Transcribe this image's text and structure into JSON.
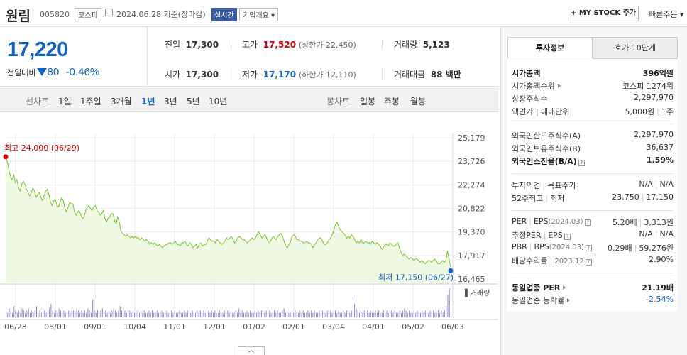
{
  "header": {
    "name": "원림",
    "code": "005820",
    "market": "코스피",
    "date": "2024.06.28 기준(장마감)",
    "realtime": "실시간",
    "overview": "기업개요 ▾",
    "mystock": "+ MY STOCK 추가",
    "quick_order": "빠른주문 ▾"
  },
  "summary": {
    "price": "17,220",
    "change_label": "전일대비",
    "change_amount": "80",
    "change_rate": "-0.46%",
    "prev_label": "전일",
    "prev": "17,300",
    "open_label": "시가",
    "open": "17,300",
    "high_label": "고가",
    "high": "17,520",
    "upper_limit": "(상한가 22,450)",
    "low_label": "저가",
    "low": "17,170",
    "lower_limit": "(하한가 12,110)",
    "volume_label": "거래량",
    "volume": "5,123",
    "amount_label": "거래대금",
    "amount": "88 백만"
  },
  "tabs": {
    "line_label": "선차트",
    "periods": [
      "1일",
      "1주일",
      "3개월",
      "1년",
      "3년",
      "5년",
      "10년"
    ],
    "active": "1년",
    "candle_label": "봉차트",
    "candles": [
      "일봉",
      "주봉",
      "월봉"
    ]
  },
  "chart_data": {
    "type": "line",
    "title": "",
    "x_ticks": [
      "06/28",
      "08/01",
      "09/01",
      "10/04",
      "11/01",
      "12/01",
      "01/02",
      "02/01",
      "03/04",
      "04/01",
      "05/02",
      "06/03"
    ],
    "y_ticks": [
      25179,
      23726,
      22274,
      20822,
      19370,
      17917,
      16465
    ],
    "ylim": [
      16465,
      25179
    ],
    "high_annotation": "최고 24,000 (06/29)",
    "low_annotation": "최저 17,150 (06/27)",
    "volume_label": "▌거래량",
    "grid": true,
    "series": [
      {
        "values": [
          24000,
          23700,
          23200,
          22800,
          22600,
          22900,
          22400,
          22600,
          22100,
          21900,
          22300,
          22500,
          22300,
          22000,
          21800,
          21600,
          21800,
          22100,
          21900,
          21500,
          21700,
          21800,
          21500,
          21300,
          21600,
          21900,
          22000,
          21700,
          21200,
          21000,
          21300,
          21400,
          21000,
          20900,
          21200,
          21500,
          21300,
          20800,
          20600,
          20900,
          21200,
          21100,
          21100,
          20600,
          20400,
          20600,
          20700,
          20400,
          20200,
          20300,
          20700,
          20900,
          21000,
          20800,
          20700,
          20900,
          21000,
          20700,
          20600,
          20400,
          20500,
          20700,
          20200,
          20000,
          20200,
          20300,
          20500,
          20500,
          20100,
          19900,
          20300,
          20000,
          19400,
          19300,
          19200,
          19100,
          19200,
          19100,
          19000,
          19100,
          19000,
          19100,
          19000,
          19000,
          18900,
          19000,
          18900,
          18800,
          18900,
          18800,
          18600,
          18700,
          18600,
          18700,
          18600,
          18500,
          18600,
          18500,
          18400,
          18500,
          18600,
          18600,
          18700,
          18700,
          18600,
          18700,
          18800,
          18600,
          18600,
          18500,
          18700,
          18700,
          18800,
          18600,
          18500,
          18700,
          18600,
          18400,
          18500,
          18600,
          18400,
          18600,
          18700,
          18500,
          18600,
          18600,
          18800,
          19000,
          18900,
          18800,
          18800,
          18700,
          18900,
          18800,
          18700,
          18600,
          18700,
          18800,
          19000,
          18900,
          19000,
          19100,
          18900,
          18700,
          18800,
          19000,
          19100,
          19000,
          18900,
          18900,
          18800,
          18700,
          18800,
          18900,
          19000,
          18900,
          19000,
          19200,
          19400,
          19200,
          19000,
          19100,
          19200,
          19000,
          18800,
          18700,
          18900,
          19100,
          19000,
          18900,
          19100,
          19200,
          19300,
          19100,
          18800,
          18500,
          18400,
          18600,
          18800,
          19100,
          19200,
          19100,
          18900,
          18900,
          18800,
          18800,
          18700,
          18700,
          18800,
          18700,
          18700,
          18600,
          18400,
          18600,
          18700,
          18900,
          19000,
          19000,
          18800,
          18600,
          18600,
          18700,
          18900,
          19000,
          19200,
          19500,
          19800,
          20000,
          19700,
          19500,
          19400,
          19300,
          19200,
          19000,
          19100,
          19000,
          19200,
          19100,
          18900,
          18700,
          18800,
          18700,
          18900,
          18700,
          18700,
          18800,
          18700,
          18700,
          18600,
          18800,
          18700,
          18600,
          18700,
          18600,
          18500,
          18300,
          18400,
          18600,
          18600,
          18500,
          18700,
          18600,
          18500,
          18500,
          18600,
          18700,
          18400,
          18100,
          17900,
          18000,
          17900,
          17800,
          17700,
          17800,
          17700,
          17600,
          17700,
          17700,
          17600,
          17500,
          17600,
          17500,
          17400,
          17500,
          17600,
          17600,
          17500,
          17600,
          17700,
          17600,
          17400,
          17400,
          17500,
          17600,
          17500,
          17600,
          18200,
          17700,
          17220
        ]
      }
    ],
    "volume": [
      3,
      2,
      4,
      3,
      2,
      5,
      3,
      2,
      3,
      2,
      4,
      3,
      2,
      3,
      4,
      2,
      3,
      2,
      3,
      5,
      2,
      3,
      2,
      4,
      3,
      2,
      3,
      4,
      6,
      3,
      2,
      3,
      2,
      4,
      3,
      2,
      3,
      2,
      4,
      3,
      2,
      3,
      3,
      2,
      4,
      3,
      2,
      3,
      2,
      3,
      2,
      4,
      3,
      2,
      8,
      3,
      2,
      3,
      2,
      3,
      4,
      2,
      3,
      2,
      3,
      2,
      3,
      4,
      3,
      2,
      3,
      5,
      3,
      2,
      3,
      2,
      2,
      3,
      2,
      3,
      2,
      3,
      2,
      2,
      3,
      2,
      3,
      2,
      2,
      3,
      2,
      3,
      2,
      2,
      3,
      2,
      2,
      3,
      2,
      2,
      3,
      2,
      2,
      3,
      2,
      3,
      2,
      2,
      3,
      2,
      2,
      3,
      2,
      3,
      2,
      2,
      3,
      2,
      2,
      3,
      2,
      3,
      2,
      3,
      2,
      2,
      3,
      2,
      3,
      2,
      3,
      2,
      2,
      3,
      2,
      2,
      3,
      2,
      3,
      2,
      3,
      2,
      2,
      3,
      2,
      4,
      2,
      3,
      2,
      2,
      3,
      2,
      3,
      2,
      2,
      3,
      2,
      3,
      2,
      3,
      2,
      2,
      3,
      2,
      3,
      2,
      2,
      3,
      2,
      3,
      2,
      2,
      3,
      4,
      2,
      3,
      2,
      2,
      3,
      2,
      3,
      2,
      2,
      3,
      2,
      3,
      2,
      2,
      3,
      2,
      3,
      2,
      3,
      2,
      2,
      3,
      2,
      3,
      2,
      2,
      3,
      2,
      3,
      2,
      2,
      3,
      2,
      3,
      2,
      2,
      3,
      2,
      3,
      2,
      2,
      3,
      9,
      6,
      4,
      3,
      2,
      3,
      2,
      3,
      2,
      3,
      2,
      3,
      2,
      2,
      3,
      2,
      3,
      2,
      2,
      3,
      2,
      3,
      2,
      2,
      3,
      2,
      3,
      2,
      2,
      3,
      2,
      3,
      4,
      3,
      2,
      3,
      2,
      2,
      3,
      2,
      3,
      2,
      2,
      3,
      2,
      3,
      2,
      2,
      3,
      2,
      3,
      2,
      2,
      3,
      2,
      3,
      2,
      3,
      5,
      10,
      13,
      6
    ]
  },
  "right": {
    "tab_invest": "투자정보",
    "tab_quote": "호가 10단계",
    "market_cap_label": "시가총액",
    "market_cap": "396억원",
    "rank_label": "시가총액순위",
    "rank": "코스피 1274위",
    "shares_label": "상장주식수",
    "shares": "2,297,970",
    "par_label": "액면가 | 매매단위",
    "par": "5,000원",
    "unit": "1주",
    "foreign_limit_label": "외국인한도주식수(A)",
    "foreign_limit": "2,297,970",
    "foreign_hold_label": "외국인보유주식수(B)",
    "foreign_hold": "36,637",
    "foreign_ratio_label": "외국인소진율(B/A)",
    "foreign_ratio": "1.59%",
    "opinion_label": "투자의견",
    "target_label": "목표주가",
    "opinion": "N/A",
    "target": "N/A",
    "w52_high_label": "52주최고",
    "w52_low_label": "최저",
    "w52_high": "23,750",
    "w52_low": "17,150",
    "per_label": "PER",
    "eps_label": "EPS",
    "eps_date": "(2024.03)",
    "per": "5.20배",
    "eps": "3,313원",
    "est_per_label": "추정PER",
    "est_eps_label": "EPS",
    "est_per": "N/A",
    "est_eps": "N/A",
    "pbr_label": "PBR",
    "bps_label": "BPS",
    "bps_date": "(2024.03)",
    "pbr": "0.29배",
    "bps": "59,276원",
    "div_label": "배당수익률",
    "div_date": "2023.12",
    "div": "2.90%",
    "ind_per_label": "동일업종 PER",
    "ind_per": "21.19배",
    "ind_rate_label": "동일업종 등락률",
    "ind_rate": "-2.54%"
  },
  "collapse_label": "︿"
}
